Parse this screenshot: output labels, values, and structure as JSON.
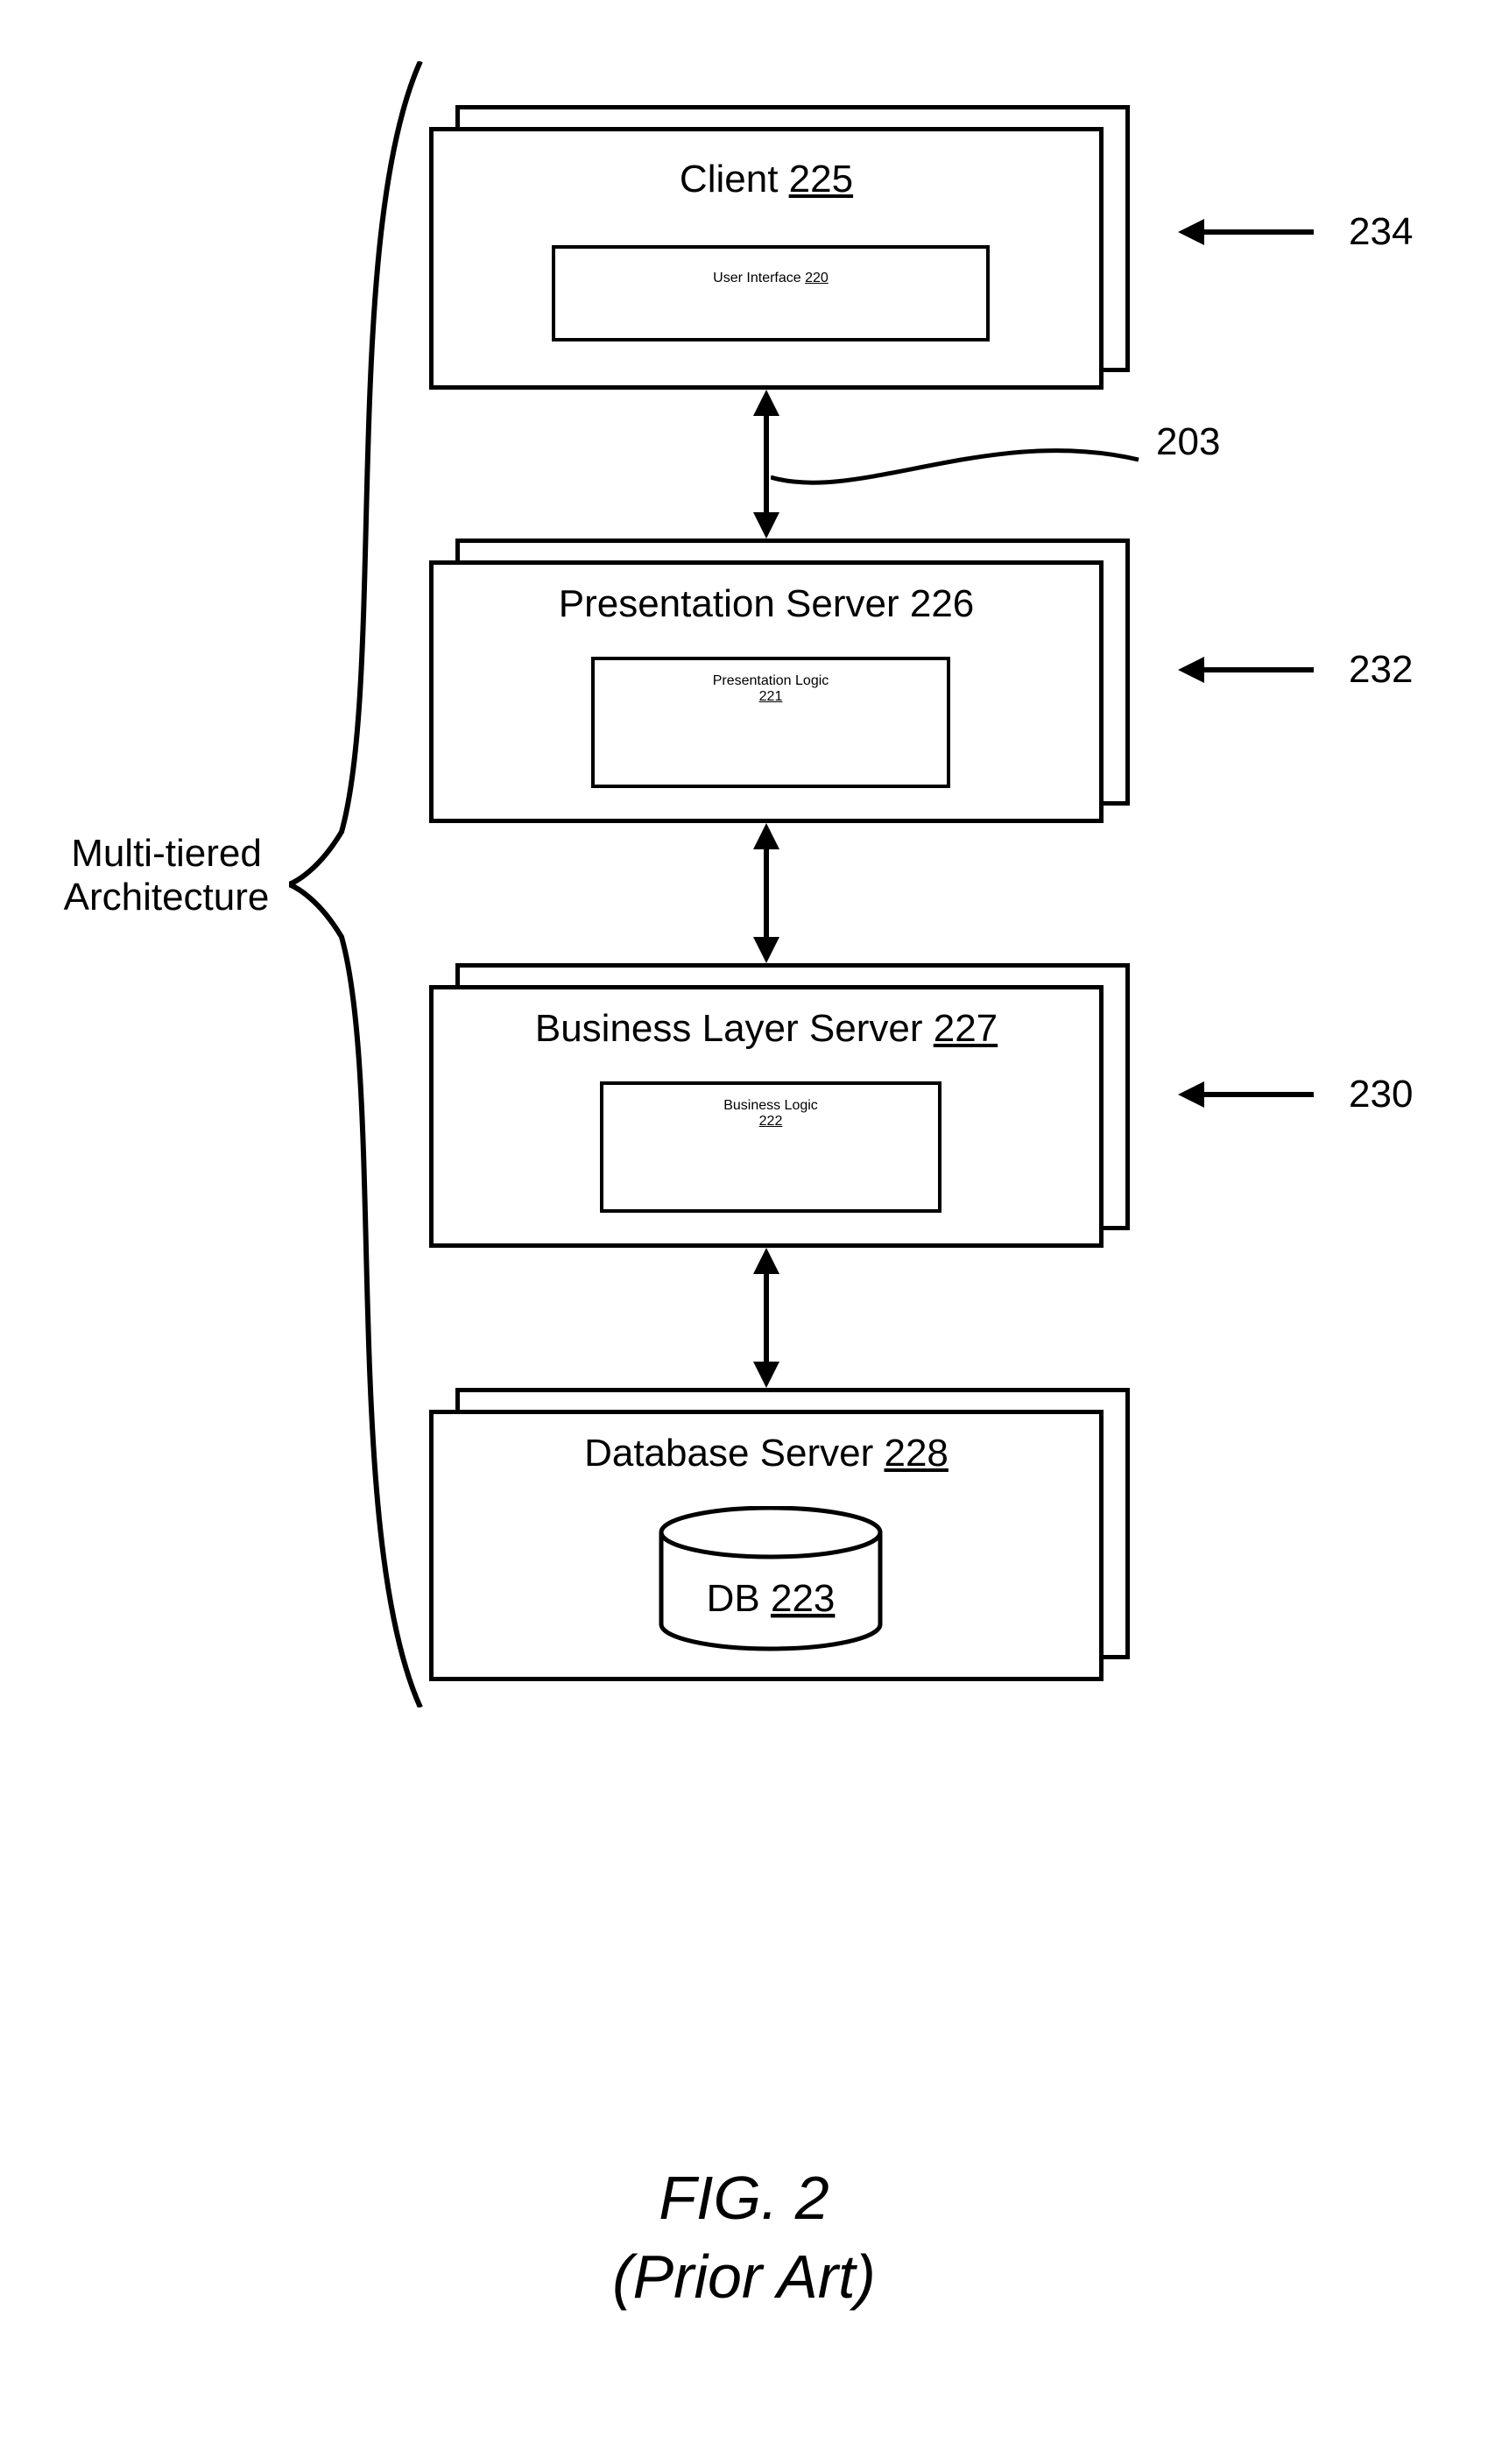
{
  "bracket_label": "Multi-tiered\nArchitecture",
  "tiers": [
    {
      "title": "Client",
      "title_ref": "225",
      "inner_title": "User Interface",
      "inner_ref": "220",
      "pointer_ref": "234"
    },
    {
      "title": "Presentation Server",
      "title_ref": "226",
      "inner_title": "Presentation Logic",
      "inner_ref": "221",
      "pointer_ref": "232"
    },
    {
      "title": "Business Layer Server",
      "title_ref": "227",
      "inner_title": "Business Logic",
      "inner_ref": "222",
      "pointer_ref": "230"
    },
    {
      "title": "Database Server",
      "title_ref": "228",
      "inner_title": "DB",
      "inner_ref": "223",
      "pointer_ref": ""
    }
  ],
  "leader_ref_203": "203",
  "figure_line1": "FIG. 2",
  "figure_line2": "(Prior Art)"
}
